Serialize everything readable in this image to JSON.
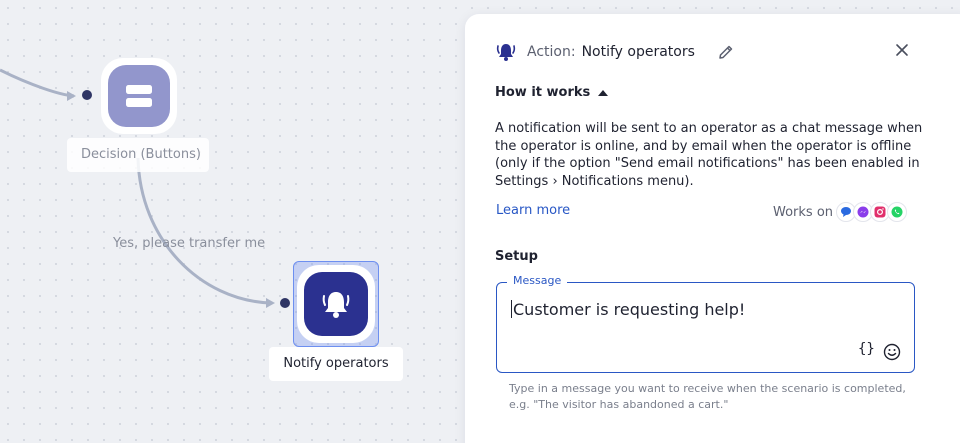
{
  "canvas": {
    "decision_node": {
      "label": "Decision (Buttons)",
      "icon": "decision-buttons-icon"
    },
    "notify_node": {
      "label": "Notify operators",
      "icon": "bell-icon"
    },
    "edge_label": "Yes, please transfer me"
  },
  "panel": {
    "header": {
      "prefix": "Action:",
      "title": "Notify operators"
    },
    "how_it_works": "How it works",
    "description": "A notification will be sent to an operator as a chat message when the operator is online, and by email when the operator is offline (only if the option \"Send email notifications\" has been enabled in Settings › Notifications menu).",
    "learn_more": "Learn more",
    "works_on": "Works on",
    "channels": [
      "chat-bubble-icon",
      "messenger-icon",
      "instagram-icon",
      "whatsapp-icon"
    ],
    "setup": "Setup",
    "message": {
      "legend": "Message",
      "value": "Customer is requesting help!",
      "variable_button": "{}",
      "hint": "Type in a message you want to receive when the scenario is completed, e.g. \"The visitor has abandoned a cart.\""
    }
  },
  "colors": {
    "accent": "#2a57c4",
    "notify_node": "#2b3190",
    "decision_node": "#9296cc"
  }
}
